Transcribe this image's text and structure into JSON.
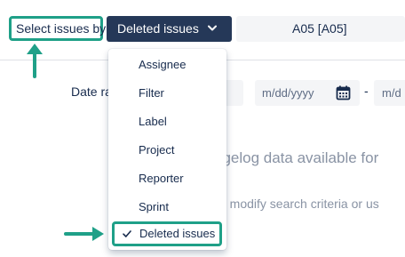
{
  "toolbar": {
    "select_label": "Select issues by:",
    "dropdown_value": "Deleted issues",
    "project_value": "A05 [A05]"
  },
  "date_filter": {
    "label": "Date ra",
    "from_placeholder": "m/dd/yyyy",
    "separator": "-",
    "to_placeholder": "m/d"
  },
  "messages": {
    "empty_state": "ngelog data available for",
    "hint": "o modify search criteria or us"
  },
  "menu": {
    "items": [
      {
        "label": "Assignee"
      },
      {
        "label": "Filter"
      },
      {
        "label": "Label"
      },
      {
        "label": "Project"
      },
      {
        "label": "Reporter"
      },
      {
        "label": "Sprint"
      },
      {
        "label": "Deleted issues",
        "selected": true
      }
    ]
  },
  "colors": {
    "highlight": "#1fa088",
    "button_bg": "#253858",
    "field_bg": "#f4f5f7"
  }
}
